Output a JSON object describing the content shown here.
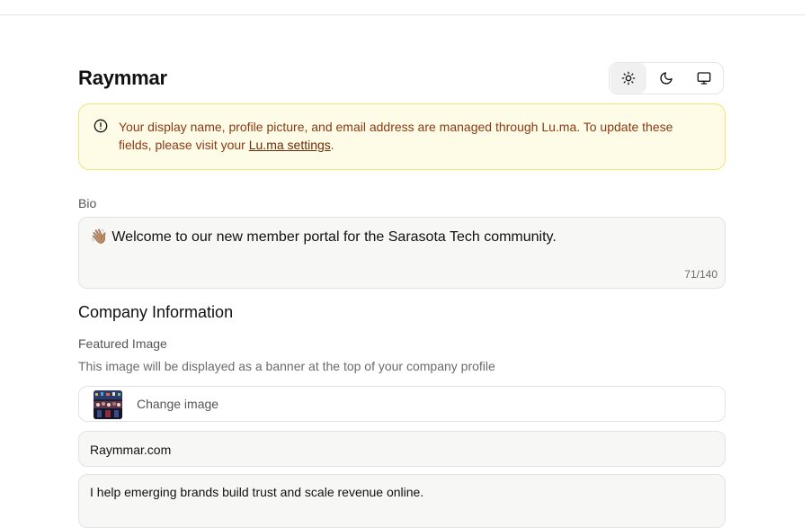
{
  "profile": {
    "name": "Raymmar"
  },
  "theme_toggle": {
    "options": [
      {
        "icon": "sun-icon",
        "label": "Light",
        "active": true
      },
      {
        "icon": "moon-icon",
        "label": "Dark",
        "active": false
      },
      {
        "icon": "monitor-icon",
        "label": "System",
        "active": false
      }
    ]
  },
  "notice": {
    "text": "Your display name, profile picture, and email address are managed through Lu.ma. To update these fields, please visit your ",
    "link_text": "Lu.ma settings",
    "suffix": ".",
    "icon": "info-circle-icon",
    "colors": {
      "background": "#fefce6",
      "border": "#f3e27a",
      "text": "#8a3a14"
    }
  },
  "bio": {
    "label": "Bio",
    "value": "👋🏽 Welcome to our new member portal for the Sarasota Tech community.",
    "counter": "71/140"
  },
  "company": {
    "section_title": "Company Information",
    "featured_image": {
      "label": "Featured Image",
      "helper": "This image will be displayed as a banner at the top of your company profile",
      "change_label": "Change image"
    },
    "website": "Raymmar.com",
    "description": "I help emerging brands build trust and scale revenue online."
  }
}
